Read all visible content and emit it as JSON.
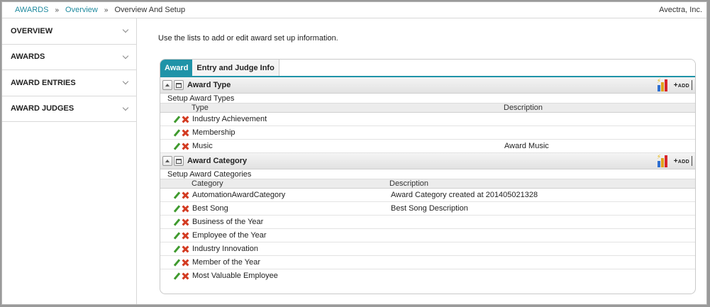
{
  "breadcrumb": {
    "items": [
      "AWARDS",
      "Overview"
    ],
    "current": "Overview And Setup",
    "separator": "»"
  },
  "company": "Avectra, Inc.",
  "sidebar": {
    "items": [
      {
        "label": "OVERVIEW"
      },
      {
        "label": "AWARDS"
      },
      {
        "label": "AWARD ENTRIES"
      },
      {
        "label": "AWARD JUDGES"
      }
    ]
  },
  "main": {
    "intro": "Use the lists to add or edit award set up information.",
    "tabs": [
      {
        "label": "Award",
        "active": true
      },
      {
        "label": "Entry and Judge Info",
        "active": false
      }
    ],
    "award_type": {
      "title": "Award Type",
      "add_label": "ADD",
      "subtitle": "Setup Award Types",
      "columns": [
        "Type",
        "Description"
      ],
      "rows": [
        {
          "type": "Industry Achievement",
          "description": ""
        },
        {
          "type": "Membership",
          "description": ""
        },
        {
          "type": "Music",
          "description": "Award Music"
        }
      ]
    },
    "award_category": {
      "title": "Award Category",
      "add_label": "ADD",
      "subtitle": "Setup Award Categories",
      "columns": [
        "Category",
        "Description"
      ],
      "rows": [
        {
          "category": "AutomationAwardCategory",
          "description": "Award Category created at 201405021328"
        },
        {
          "category": "Best Song",
          "description": "Best Song Description"
        },
        {
          "category": "Business of the Year",
          "description": ""
        },
        {
          "category": "Employee of the Year",
          "description": ""
        },
        {
          "category": "Industry Innovation",
          "description": ""
        },
        {
          "category": "Member of the Year",
          "description": ""
        },
        {
          "category": "Most Valuable Employee",
          "description": ""
        }
      ]
    }
  },
  "colors": {
    "accent": "#1f93a8",
    "link": "#1f8a9e"
  }
}
